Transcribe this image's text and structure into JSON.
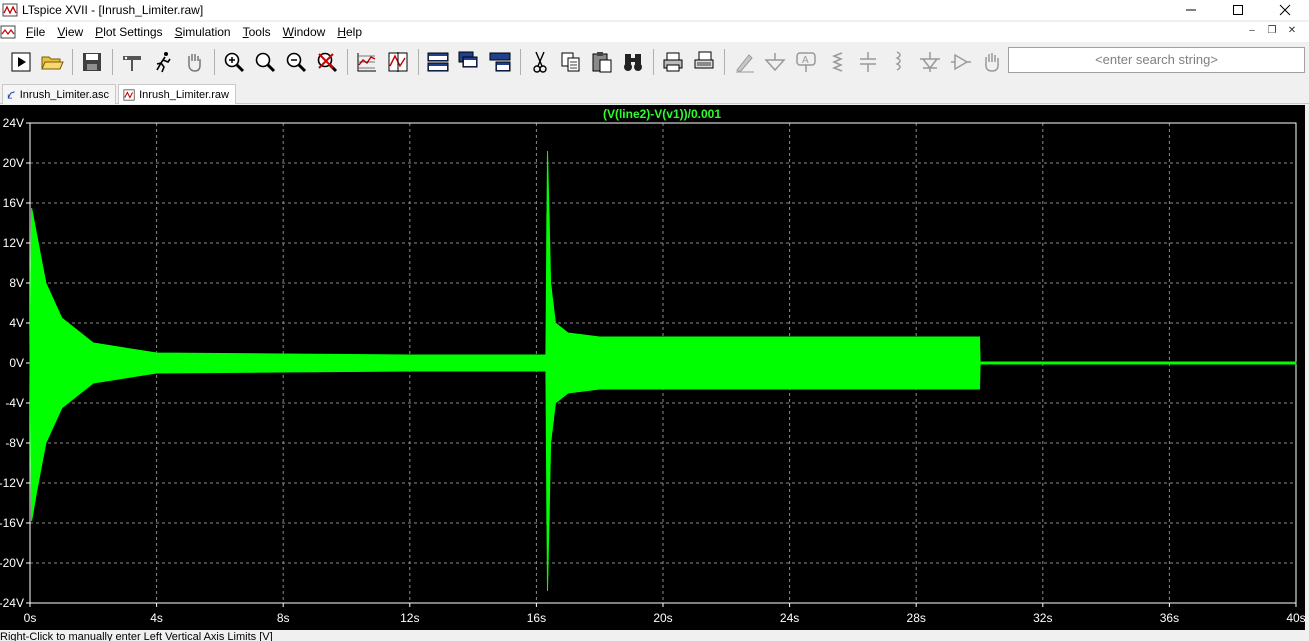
{
  "window": {
    "title": "LTspice XVII - [Inrush_Limiter.raw]",
    "minimize_label": "minimize",
    "maximize_label": "maximize",
    "close_label": "close"
  },
  "menu": {
    "items": [
      {
        "key": "F",
        "rest": "ile"
      },
      {
        "key": "V",
        "rest": "iew"
      },
      {
        "key": "P",
        "rest": "lot Settings"
      },
      {
        "key": "S",
        "rest": "imulation"
      },
      {
        "key": "T",
        "rest": "ools"
      },
      {
        "key": "W",
        "rest": "indow"
      },
      {
        "key": "H",
        "rest": "elp"
      }
    ]
  },
  "toolbar": {
    "search_placeholder": "<enter search string>",
    "icons": [
      "run-icon",
      "open-icon",
      "save-icon",
      "control-panel-icon",
      "run-man-icon",
      "pan-hand-icon",
      "zoom-in-icon",
      "zoom-fit-icon",
      "zoom-out-icon",
      "zoom-cancel-icon",
      "autorange-icon",
      "mark-icon",
      "tile-horizontal-icon",
      "cascade-icon",
      "tile-vertical-icon",
      "cut-icon",
      "copy-icon",
      "paste-icon",
      "find-icon",
      "print-icon",
      "print-setup-icon",
      "wire-icon",
      "ground-icon",
      "label-icon",
      "resistor-icon",
      "capacitor-icon",
      "inductor-icon",
      "diode-icon",
      "component-icon",
      "move-hand-icon"
    ]
  },
  "tabs": [
    {
      "label": "Inrush_Limiter.asc",
      "icon": "schematic-icon"
    },
    {
      "label": "Inrush_Limiter.raw",
      "icon": "waveform-icon"
    }
  ],
  "status": {
    "text": "Right-Click to manually enter Left Vertical Axis Limits [V]"
  },
  "colors": {
    "trace": "#00ff00",
    "label": "#2cff2c",
    "plot_bg": "#000000",
    "grid": "#8a8a8a"
  },
  "chart_data": {
    "type": "line",
    "trace_label": "(V(line2)-V(v1))/0.001",
    "xlim": [
      0,
      40
    ],
    "ylim": [
      -24,
      24
    ],
    "x_unit": "s",
    "y_unit": "V",
    "x_ticks": [
      "0s",
      "4s",
      "8s",
      "12s",
      "16s",
      "20s",
      "24s",
      "28s",
      "32s",
      "36s",
      "40s"
    ],
    "y_ticks": [
      "24V",
      "20V",
      "16V",
      "12V",
      "8V",
      "4V",
      "0V",
      "-4V",
      "-8V",
      "-12V",
      "-16V",
      "-20V",
      "-24V"
    ],
    "grid": true,
    "series": [
      {
        "name": "(V(line2)-V(v1))/0.001",
        "envelope_x": [
          0,
          0.05,
          0.2,
          0.5,
          1,
          2,
          4,
          8,
          12,
          16.3,
          16.35,
          16.45,
          16.6,
          17,
          18,
          20,
          24,
          28,
          30,
          30.02,
          40
        ],
        "envelope_upper": [
          0,
          15.5,
          13,
          8,
          4.5,
          2,
          1,
          0.9,
          0.8,
          0.8,
          21.2,
          8,
          4,
          3,
          2.6,
          2.6,
          2.6,
          2.6,
          2.6,
          0.1,
          0.1
        ],
        "envelope_lower": [
          0,
          -15.8,
          -13,
          -8,
          -4.5,
          -2,
          -1,
          -0.9,
          -0.8,
          -0.8,
          -22.8,
          -8,
          -4,
          -3,
          -2.6,
          -2.6,
          -2.6,
          -2.6,
          -2.6,
          -0.1,
          -0.1
        ]
      }
    ]
  }
}
